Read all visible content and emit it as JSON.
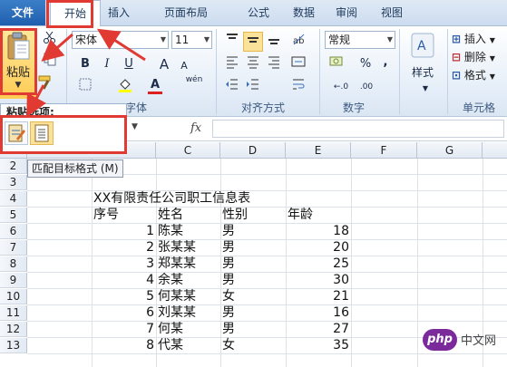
{
  "tabs": {
    "file": "文件",
    "home": "开始",
    "insert": "插入",
    "page_layout": "页面布局",
    "formulas": "公式",
    "data": "数据",
    "review": "审阅",
    "view": "视图"
  },
  "ribbon": {
    "paste_label": "粘贴",
    "font_name": "宋体",
    "font_size": "11",
    "bold": "B",
    "italic": "I",
    "underline": "U",
    "grow_font": "A",
    "shrink_font": "A",
    "font_group": "字体",
    "align_group": "对齐方式",
    "number_format": "常规",
    "percent": "%",
    "comma": ",",
    "number_group": "数字",
    "style_label": "样式",
    "insert_label": "插入",
    "delete_label": "删除",
    "format_label": "格式",
    "cells_group": "单元格",
    "wen_label": "wén"
  },
  "popup": {
    "title": "粘贴选项:",
    "tooltip": "匹配目标格式 (M)"
  },
  "formula_bar": {
    "fx": "fx"
  },
  "columns": [
    "C",
    "D",
    "E",
    "F",
    "G"
  ],
  "rows": [
    "2",
    "3",
    "4",
    "5",
    "6",
    "7",
    "8",
    "9",
    "10",
    "11",
    "12",
    "13"
  ],
  "sheet": {
    "title": "XX有限责任公司职工信息表",
    "headers": [
      "序号",
      "姓名",
      "性别",
      "年龄"
    ],
    "records": [
      {
        "no": "1",
        "name": "陈某",
        "gender": "男",
        "age": "18"
      },
      {
        "no": "2",
        "name": "张某某",
        "gender": "男",
        "age": "20"
      },
      {
        "no": "3",
        "name": "郑某某",
        "gender": "男",
        "age": "25"
      },
      {
        "no": "4",
        "name": "余某",
        "gender": "男",
        "age": "30"
      },
      {
        "no": "5",
        "name": "何某某",
        "gender": "女",
        "age": "21"
      },
      {
        "no": "6",
        "name": "刘某某",
        "gender": "男",
        "age": "16"
      },
      {
        "no": "7",
        "name": "何某",
        "gender": "男",
        "age": "27"
      },
      {
        "no": "8",
        "name": "代某",
        "gender": "女",
        "age": "35"
      }
    ]
  },
  "watermark": {
    "logo": "php",
    "text": "中文网"
  },
  "colors": {
    "highlight": "#e03a33",
    "paste_button": "#ffcc55"
  }
}
